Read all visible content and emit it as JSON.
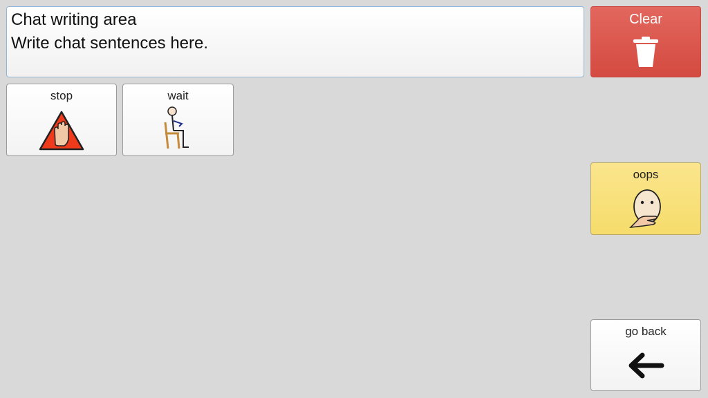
{
  "chat": {
    "title": "Chat writing area",
    "placeholder": "Write chat sentences here."
  },
  "clear": {
    "label": "Clear",
    "icon": "trash-icon",
    "color": "#d9534f"
  },
  "tiles": {
    "stop": {
      "label": "stop",
      "icon": "stop-hand-icon"
    },
    "wait": {
      "label": "wait",
      "icon": "wait-person-icon"
    },
    "oops": {
      "label": "oops",
      "icon": "oops-face-icon",
      "color": "#f8e07a"
    },
    "go_back": {
      "label": "go back",
      "icon": "arrow-left-icon"
    }
  }
}
